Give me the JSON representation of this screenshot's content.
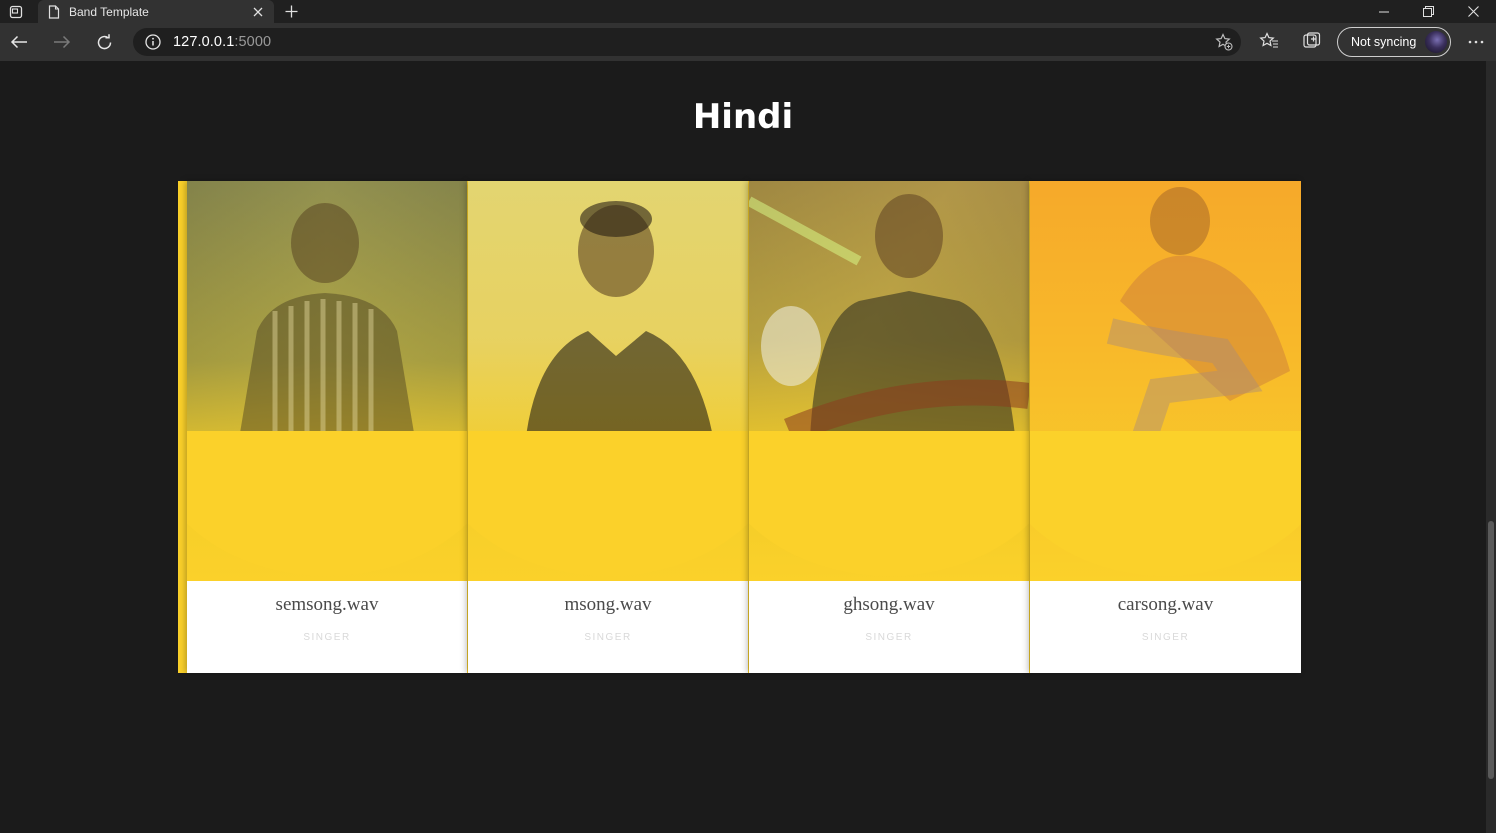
{
  "browser": {
    "tab_title": "Band Template",
    "url_host": "127.0.0.1",
    "url_port": ":5000",
    "profile_label": "Not syncing"
  },
  "page": {
    "heading": "Hindi",
    "cards": [
      {
        "name": "semsong.wav",
        "role": "SINGER"
      },
      {
        "name": "msong.wav",
        "role": "SINGER"
      },
      {
        "name": "ghsong.wav",
        "role": "SINGER"
      },
      {
        "name": "carsong.wav",
        "role": "SINGER"
      }
    ]
  },
  "colors": {
    "page_bg": "#1b1b1b",
    "accent_yellow": "#fbd12a",
    "card_bg": "#ffffff"
  },
  "icons": [
    "tab-actions-icon",
    "page-icon",
    "close-icon",
    "plus-icon",
    "minimize-icon",
    "restore-icon",
    "window-close-icon",
    "back-arrow-icon",
    "forward-arrow-icon",
    "refresh-icon",
    "info-icon",
    "add-favorite-icon",
    "favorites-icon",
    "collections-icon",
    "more-icon"
  ]
}
